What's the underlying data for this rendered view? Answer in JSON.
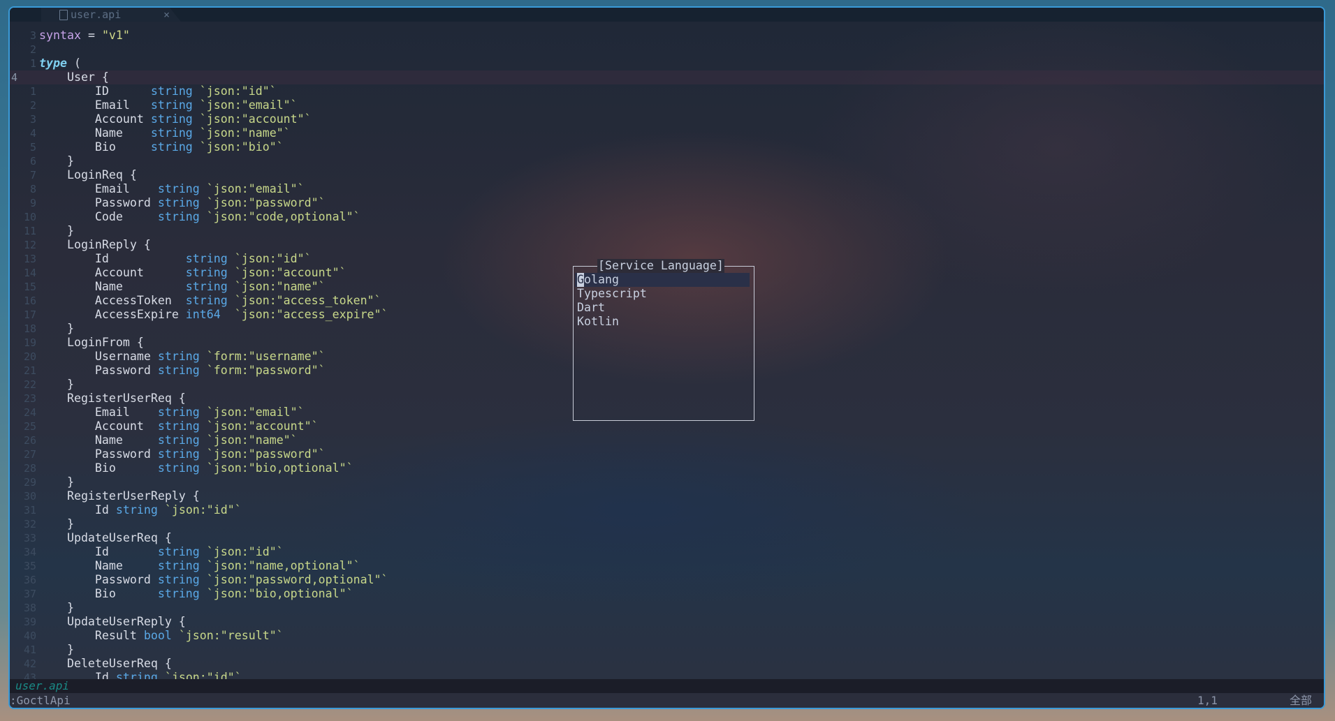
{
  "tab": {
    "filename": "user.api",
    "close": "×",
    "icon": "file-icon"
  },
  "code": [
    {
      "n": "3",
      "t": [
        [
          "kw",
          "syntax"
        ],
        [
          "id",
          " = "
        ],
        [
          "str",
          "\"v1\""
        ]
      ]
    },
    {
      "n": "2",
      "t": []
    },
    {
      "n": "1",
      "t": [
        [
          "ty",
          "type"
        ],
        [
          "id",
          " ("
        ]
      ]
    },
    {
      "n": "4",
      "cur": true,
      "t": [
        [
          "id",
          "    User {"
        ]
      ]
    },
    {
      "n": "1",
      "t": [
        [
          "id",
          "        ID      "
        ],
        [
          "tp",
          "string"
        ],
        [
          "tag",
          " `json:\"id\"`"
        ]
      ]
    },
    {
      "n": "2",
      "t": [
        [
          "id",
          "        Email   "
        ],
        [
          "tp",
          "string"
        ],
        [
          "tag",
          " `json:\"email\"`"
        ]
      ]
    },
    {
      "n": "3",
      "t": [
        [
          "id",
          "        Account "
        ],
        [
          "tp",
          "string"
        ],
        [
          "tag",
          " `json:\"account\"`"
        ]
      ]
    },
    {
      "n": "4",
      "t": [
        [
          "id",
          "        Name    "
        ],
        [
          "tp",
          "string"
        ],
        [
          "tag",
          " `json:\"name\"`"
        ]
      ]
    },
    {
      "n": "5",
      "t": [
        [
          "id",
          "        Bio     "
        ],
        [
          "tp",
          "string"
        ],
        [
          "tag",
          " `json:\"bio\"`"
        ]
      ]
    },
    {
      "n": "6",
      "t": [
        [
          "id",
          "    }"
        ]
      ]
    },
    {
      "n": "7",
      "t": [
        [
          "id",
          "    LoginReq {"
        ]
      ]
    },
    {
      "n": "8",
      "t": [
        [
          "id",
          "        Email    "
        ],
        [
          "tp",
          "string"
        ],
        [
          "tag",
          " `json:\"email\"`"
        ]
      ]
    },
    {
      "n": "9",
      "t": [
        [
          "id",
          "        Password "
        ],
        [
          "tp",
          "string"
        ],
        [
          "tag",
          " `json:\"password\"`"
        ]
      ]
    },
    {
      "n": "10",
      "t": [
        [
          "id",
          "        Code     "
        ],
        [
          "tp",
          "string"
        ],
        [
          "tag",
          " `json:\"code,optional\"`"
        ]
      ]
    },
    {
      "n": "11",
      "t": [
        [
          "id",
          "    }"
        ]
      ]
    },
    {
      "n": "12",
      "t": [
        [
          "id",
          "    LoginReply {"
        ]
      ]
    },
    {
      "n": "13",
      "t": [
        [
          "id",
          "        Id           "
        ],
        [
          "tp",
          "string"
        ],
        [
          "tag",
          " `json:\"id\"`"
        ]
      ]
    },
    {
      "n": "14",
      "t": [
        [
          "id",
          "        Account      "
        ],
        [
          "tp",
          "string"
        ],
        [
          "tag",
          " `json:\"account\"`"
        ]
      ]
    },
    {
      "n": "15",
      "t": [
        [
          "id",
          "        Name         "
        ],
        [
          "tp",
          "string"
        ],
        [
          "tag",
          " `json:\"name\"`"
        ]
      ]
    },
    {
      "n": "16",
      "t": [
        [
          "id",
          "        AccessToken  "
        ],
        [
          "tp",
          "string"
        ],
        [
          "tag",
          " `json:\"access_token\"`"
        ]
      ]
    },
    {
      "n": "17",
      "t": [
        [
          "id",
          "        AccessExpire "
        ],
        [
          "tp",
          "int64 "
        ],
        [
          "tag",
          " `json:\"access_expire\"`"
        ]
      ]
    },
    {
      "n": "18",
      "t": [
        [
          "id",
          "    }"
        ]
      ]
    },
    {
      "n": "19",
      "t": [
        [
          "id",
          "    LoginFrom {"
        ]
      ]
    },
    {
      "n": "20",
      "t": [
        [
          "id",
          "        Username "
        ],
        [
          "tp",
          "string"
        ],
        [
          "tag",
          " `form:\"username\"`"
        ]
      ]
    },
    {
      "n": "21",
      "t": [
        [
          "id",
          "        Password "
        ],
        [
          "tp",
          "string"
        ],
        [
          "tag",
          " `form:\"password\"`"
        ]
      ]
    },
    {
      "n": "22",
      "t": [
        [
          "id",
          "    }"
        ]
      ]
    },
    {
      "n": "23",
      "t": [
        [
          "id",
          "    RegisterUserReq {"
        ]
      ]
    },
    {
      "n": "24",
      "t": [
        [
          "id",
          "        Email    "
        ],
        [
          "tp",
          "string"
        ],
        [
          "tag",
          " `json:\"email\"`"
        ]
      ]
    },
    {
      "n": "25",
      "t": [
        [
          "id",
          "        Account  "
        ],
        [
          "tp",
          "string"
        ],
        [
          "tag",
          " `json:\"account\"`"
        ]
      ]
    },
    {
      "n": "26",
      "t": [
        [
          "id",
          "        Name     "
        ],
        [
          "tp",
          "string"
        ],
        [
          "tag",
          " `json:\"name\"`"
        ]
      ]
    },
    {
      "n": "27",
      "t": [
        [
          "id",
          "        Password "
        ],
        [
          "tp",
          "string"
        ],
        [
          "tag",
          " `json:\"password\"`"
        ]
      ]
    },
    {
      "n": "28",
      "t": [
        [
          "id",
          "        Bio      "
        ],
        [
          "tp",
          "string"
        ],
        [
          "tag",
          " `json:\"bio,optional\"`"
        ]
      ]
    },
    {
      "n": "29",
      "t": [
        [
          "id",
          "    }"
        ]
      ]
    },
    {
      "n": "30",
      "t": [
        [
          "id",
          "    RegisterUserReply {"
        ]
      ]
    },
    {
      "n": "31",
      "t": [
        [
          "id",
          "        Id "
        ],
        [
          "tp",
          "string"
        ],
        [
          "tag",
          " `json:\"id\"`"
        ]
      ]
    },
    {
      "n": "32",
      "t": [
        [
          "id",
          "    }"
        ]
      ]
    },
    {
      "n": "33",
      "t": [
        [
          "id",
          "    UpdateUserReq {"
        ]
      ]
    },
    {
      "n": "34",
      "t": [
        [
          "id",
          "        Id       "
        ],
        [
          "tp",
          "string"
        ],
        [
          "tag",
          " `json:\"id\"`"
        ]
      ]
    },
    {
      "n": "35",
      "t": [
        [
          "id",
          "        Name     "
        ],
        [
          "tp",
          "string"
        ],
        [
          "tag",
          " `json:\"name,optional\"`"
        ]
      ]
    },
    {
      "n": "36",
      "t": [
        [
          "id",
          "        Password "
        ],
        [
          "tp",
          "string"
        ],
        [
          "tag",
          " `json:\"password,optional\"`"
        ]
      ]
    },
    {
      "n": "37",
      "t": [
        [
          "id",
          "        Bio      "
        ],
        [
          "tp",
          "string"
        ],
        [
          "tag",
          " `json:\"bio,optional\"`"
        ]
      ]
    },
    {
      "n": "38",
      "t": [
        [
          "id",
          "    }"
        ]
      ]
    },
    {
      "n": "39",
      "t": [
        [
          "id",
          "    UpdateUserReply {"
        ]
      ]
    },
    {
      "n": "40",
      "t": [
        [
          "id",
          "        Result "
        ],
        [
          "tp",
          "bool"
        ],
        [
          "tag",
          " `json:\"result\"`"
        ]
      ]
    },
    {
      "n": "41",
      "t": [
        [
          "id",
          "    }"
        ]
      ]
    },
    {
      "n": "42",
      "t": [
        [
          "id",
          "    DeleteUserReq {"
        ]
      ]
    },
    {
      "n": "43",
      "t": [
        [
          "id",
          "        Id "
        ],
        [
          "tp",
          "string"
        ],
        [
          "tag",
          " `json:\"id\"`"
        ]
      ]
    }
  ],
  "popup": {
    "title": "[Service Language]",
    "items": [
      {
        "first": "G",
        "rest": "olang",
        "selected": true
      },
      {
        "label": "Typescript"
      },
      {
        "label": "Dart"
      },
      {
        "label": "Kotlin"
      }
    ]
  },
  "statusline": {
    "filename": "user.api"
  },
  "cmdline": {
    "command": ":GoctlApi",
    "position": "1,1",
    "scroll": "全部"
  }
}
